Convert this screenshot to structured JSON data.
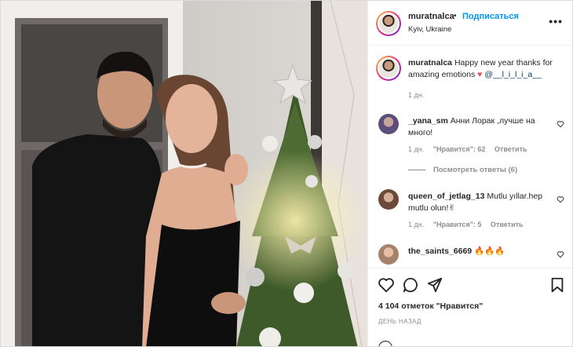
{
  "post": {
    "username": "muratnalca",
    "separator": "•",
    "follow_label": "Подписаться",
    "location": "Kyiv, Ukraine",
    "more_label": "•••"
  },
  "caption": {
    "username": "muratnalca",
    "text": "Happy new year thanks for amazing emotions",
    "heart": "♥",
    "mention": "@__l_i_l_i_a__",
    "time": "1 дн."
  },
  "comments": [
    {
      "username": "_yana_sm",
      "text": "Анни Лорак ,лучше на много!",
      "time": "1 дн.",
      "likes": "\"Нравится\": 62",
      "reply": "Ответить",
      "avatar_color": "#5b4e7a"
    },
    {
      "username": "queen_of_jetlag_13",
      "text": "Mutlu yıllar.hep mutlu olun!✌",
      "time": "1 дн.",
      "likes": "\"Нравится\": 5",
      "reply": "Ответить",
      "avatar_color": "#6b4a3a"
    },
    {
      "username": "the_saints_6669",
      "text": "🔥🔥🔥",
      "avatar_color": "#a7826a"
    }
  ],
  "view_replies": "Посмотреть ответы (6)",
  "footer": {
    "likes": "4 104 отметок \"Нравится\"",
    "ago": "ДЕНЬ НАЗАД"
  },
  "icons": {
    "like": "heart-icon",
    "comment": "comment-icon",
    "share": "paper-plane-icon",
    "save": "bookmark-icon",
    "more": "more-icon",
    "chevron": "like-comment-heart-icon"
  },
  "colors": {
    "accent": "#0095f6",
    "muted": "#8e8e8e",
    "text": "#262626",
    "heart": "#ed4956"
  }
}
